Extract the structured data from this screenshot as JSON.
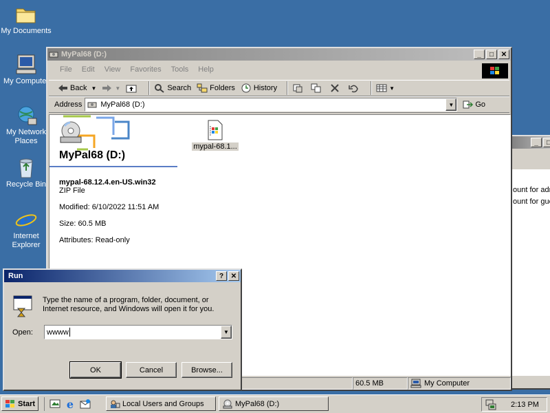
{
  "desktop": {
    "icons": [
      {
        "label": "My Documents"
      },
      {
        "label": "My Computer"
      },
      {
        "label": "My Network Places"
      },
      {
        "label": "Recycle Bin"
      },
      {
        "label": "Internet Explorer"
      }
    ]
  },
  "bg_window": {
    "text1": "ount for adr",
    "text2": "ount for gue"
  },
  "explorer": {
    "title": "MyPal68 (D:)",
    "menu": [
      "File",
      "Edit",
      "View",
      "Favorites",
      "Tools",
      "Help"
    ],
    "toolbar": {
      "back": "Back",
      "search": "Search",
      "folders": "Folders",
      "history": "History"
    },
    "address": {
      "label": "Address",
      "value": "MyPal68 (D:)",
      "go": "Go"
    },
    "panel": {
      "drive_title": "MyPal68 (D:)",
      "file_name": "mypal-68.12.4.en-US.win32",
      "file_type": "ZIP File",
      "modified": "Modified: 6/10/2022 11:51 AM",
      "size": "Size: 60.5 MB",
      "attributes": "Attributes: Read-only"
    },
    "file_item": "mypal-68.1...",
    "status": {
      "size": "60.5 MB",
      "zone": "My Computer"
    }
  },
  "run": {
    "title": "Run",
    "description": "Type the name of a program, folder, document, or Internet resource, and Windows will open it for you.",
    "open_label": "Open:",
    "open_value": "wwww",
    "ok": "OK",
    "cancel": "Cancel",
    "browse": "Browse..."
  },
  "taskbar": {
    "start": "Start",
    "tasks": [
      {
        "label": "Local Users and Groups"
      },
      {
        "label": "MyPal68 (D:)"
      }
    ],
    "clock": "2:13 PM"
  }
}
